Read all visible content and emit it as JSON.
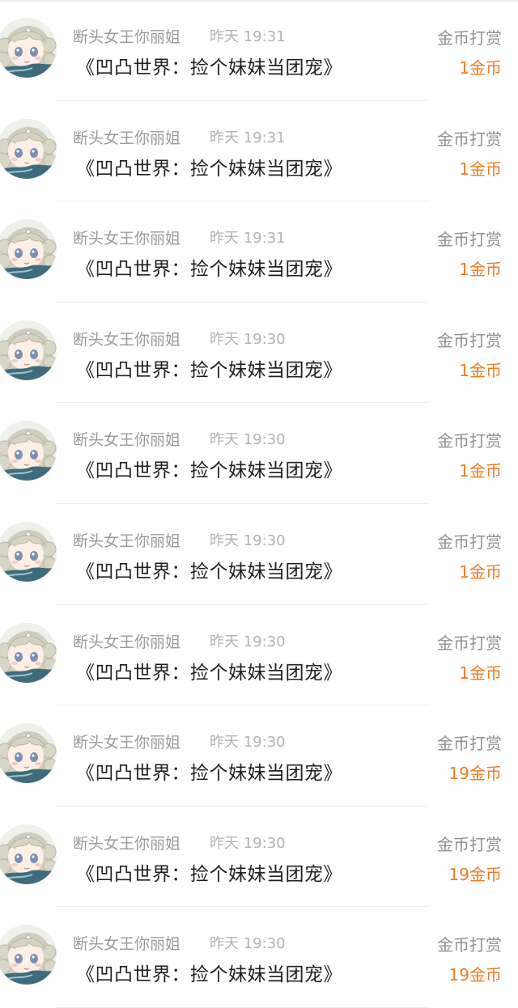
{
  "accent_color": "#f07a23",
  "avatar_icon": "anime-girl-avatar-icon",
  "rewards": [
    {
      "username": "断头女王你丽姐",
      "time": "昨天 19:31",
      "book": "《凹凸世界：捡个妹妹当团宠》",
      "label": "金币打赏",
      "amount": "1金币"
    },
    {
      "username": "断头女王你丽姐",
      "time": "昨天 19:31",
      "book": "《凹凸世界：捡个妹妹当团宠》",
      "label": "金币打赏",
      "amount": "1金币"
    },
    {
      "username": "断头女王你丽姐",
      "time": "昨天 19:31",
      "book": "《凹凸世界：捡个妹妹当团宠》",
      "label": "金币打赏",
      "amount": "1金币"
    },
    {
      "username": "断头女王你丽姐",
      "time": "昨天 19:30",
      "book": "《凹凸世界：捡个妹妹当团宠》",
      "label": "金币打赏",
      "amount": "1金币"
    },
    {
      "username": "断头女王你丽姐",
      "time": "昨天 19:30",
      "book": "《凹凸世界：捡个妹妹当团宠》",
      "label": "金币打赏",
      "amount": "1金币"
    },
    {
      "username": "断头女王你丽姐",
      "time": "昨天 19:30",
      "book": "《凹凸世界：捡个妹妹当团宠》",
      "label": "金币打赏",
      "amount": "1金币"
    },
    {
      "username": "断头女王你丽姐",
      "time": "昨天 19:30",
      "book": "《凹凸世界：捡个妹妹当团宠》",
      "label": "金币打赏",
      "amount": "1金币"
    },
    {
      "username": "断头女王你丽姐",
      "time": "昨天 19:30",
      "book": "《凹凸世界：捡个妹妹当团宠》",
      "label": "金币打赏",
      "amount": "19金币"
    },
    {
      "username": "断头女王你丽姐",
      "time": "昨天 19:30",
      "book": "《凹凸世界：捡个妹妹当团宠》",
      "label": "金币打赏",
      "amount": "19金币"
    },
    {
      "username": "断头女王你丽姐",
      "time": "昨天 19:30",
      "book": "《凹凸世界：捡个妹妹当团宠》",
      "label": "金币打赏",
      "amount": "19金币"
    }
  ]
}
